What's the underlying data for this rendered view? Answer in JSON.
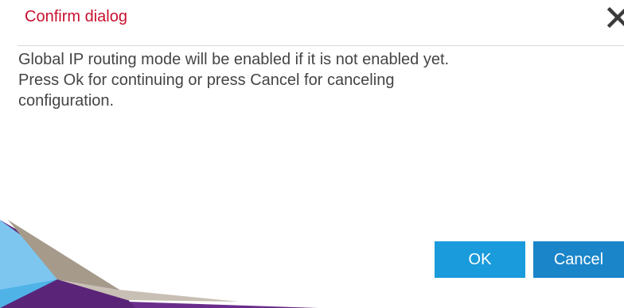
{
  "dialog": {
    "title": "Confirm dialog",
    "message_lines": [
      "Global IP routing mode will be enabled if it is not enabled yet.",
      "Press Ok for continuing or press Cancel for canceling",
      "configuration."
    ],
    "close_icon": "close-icon",
    "ok_label": "OK",
    "cancel_label": "Cancel"
  },
  "colors": {
    "title": "#c8102e",
    "button_primary": "#1a9bdb",
    "button_secondary": "#1a85c9",
    "decor_purple": "#6b2d8c",
    "decor_blue": "#4fb3e8",
    "decor_taupe": "#a69a8b"
  }
}
